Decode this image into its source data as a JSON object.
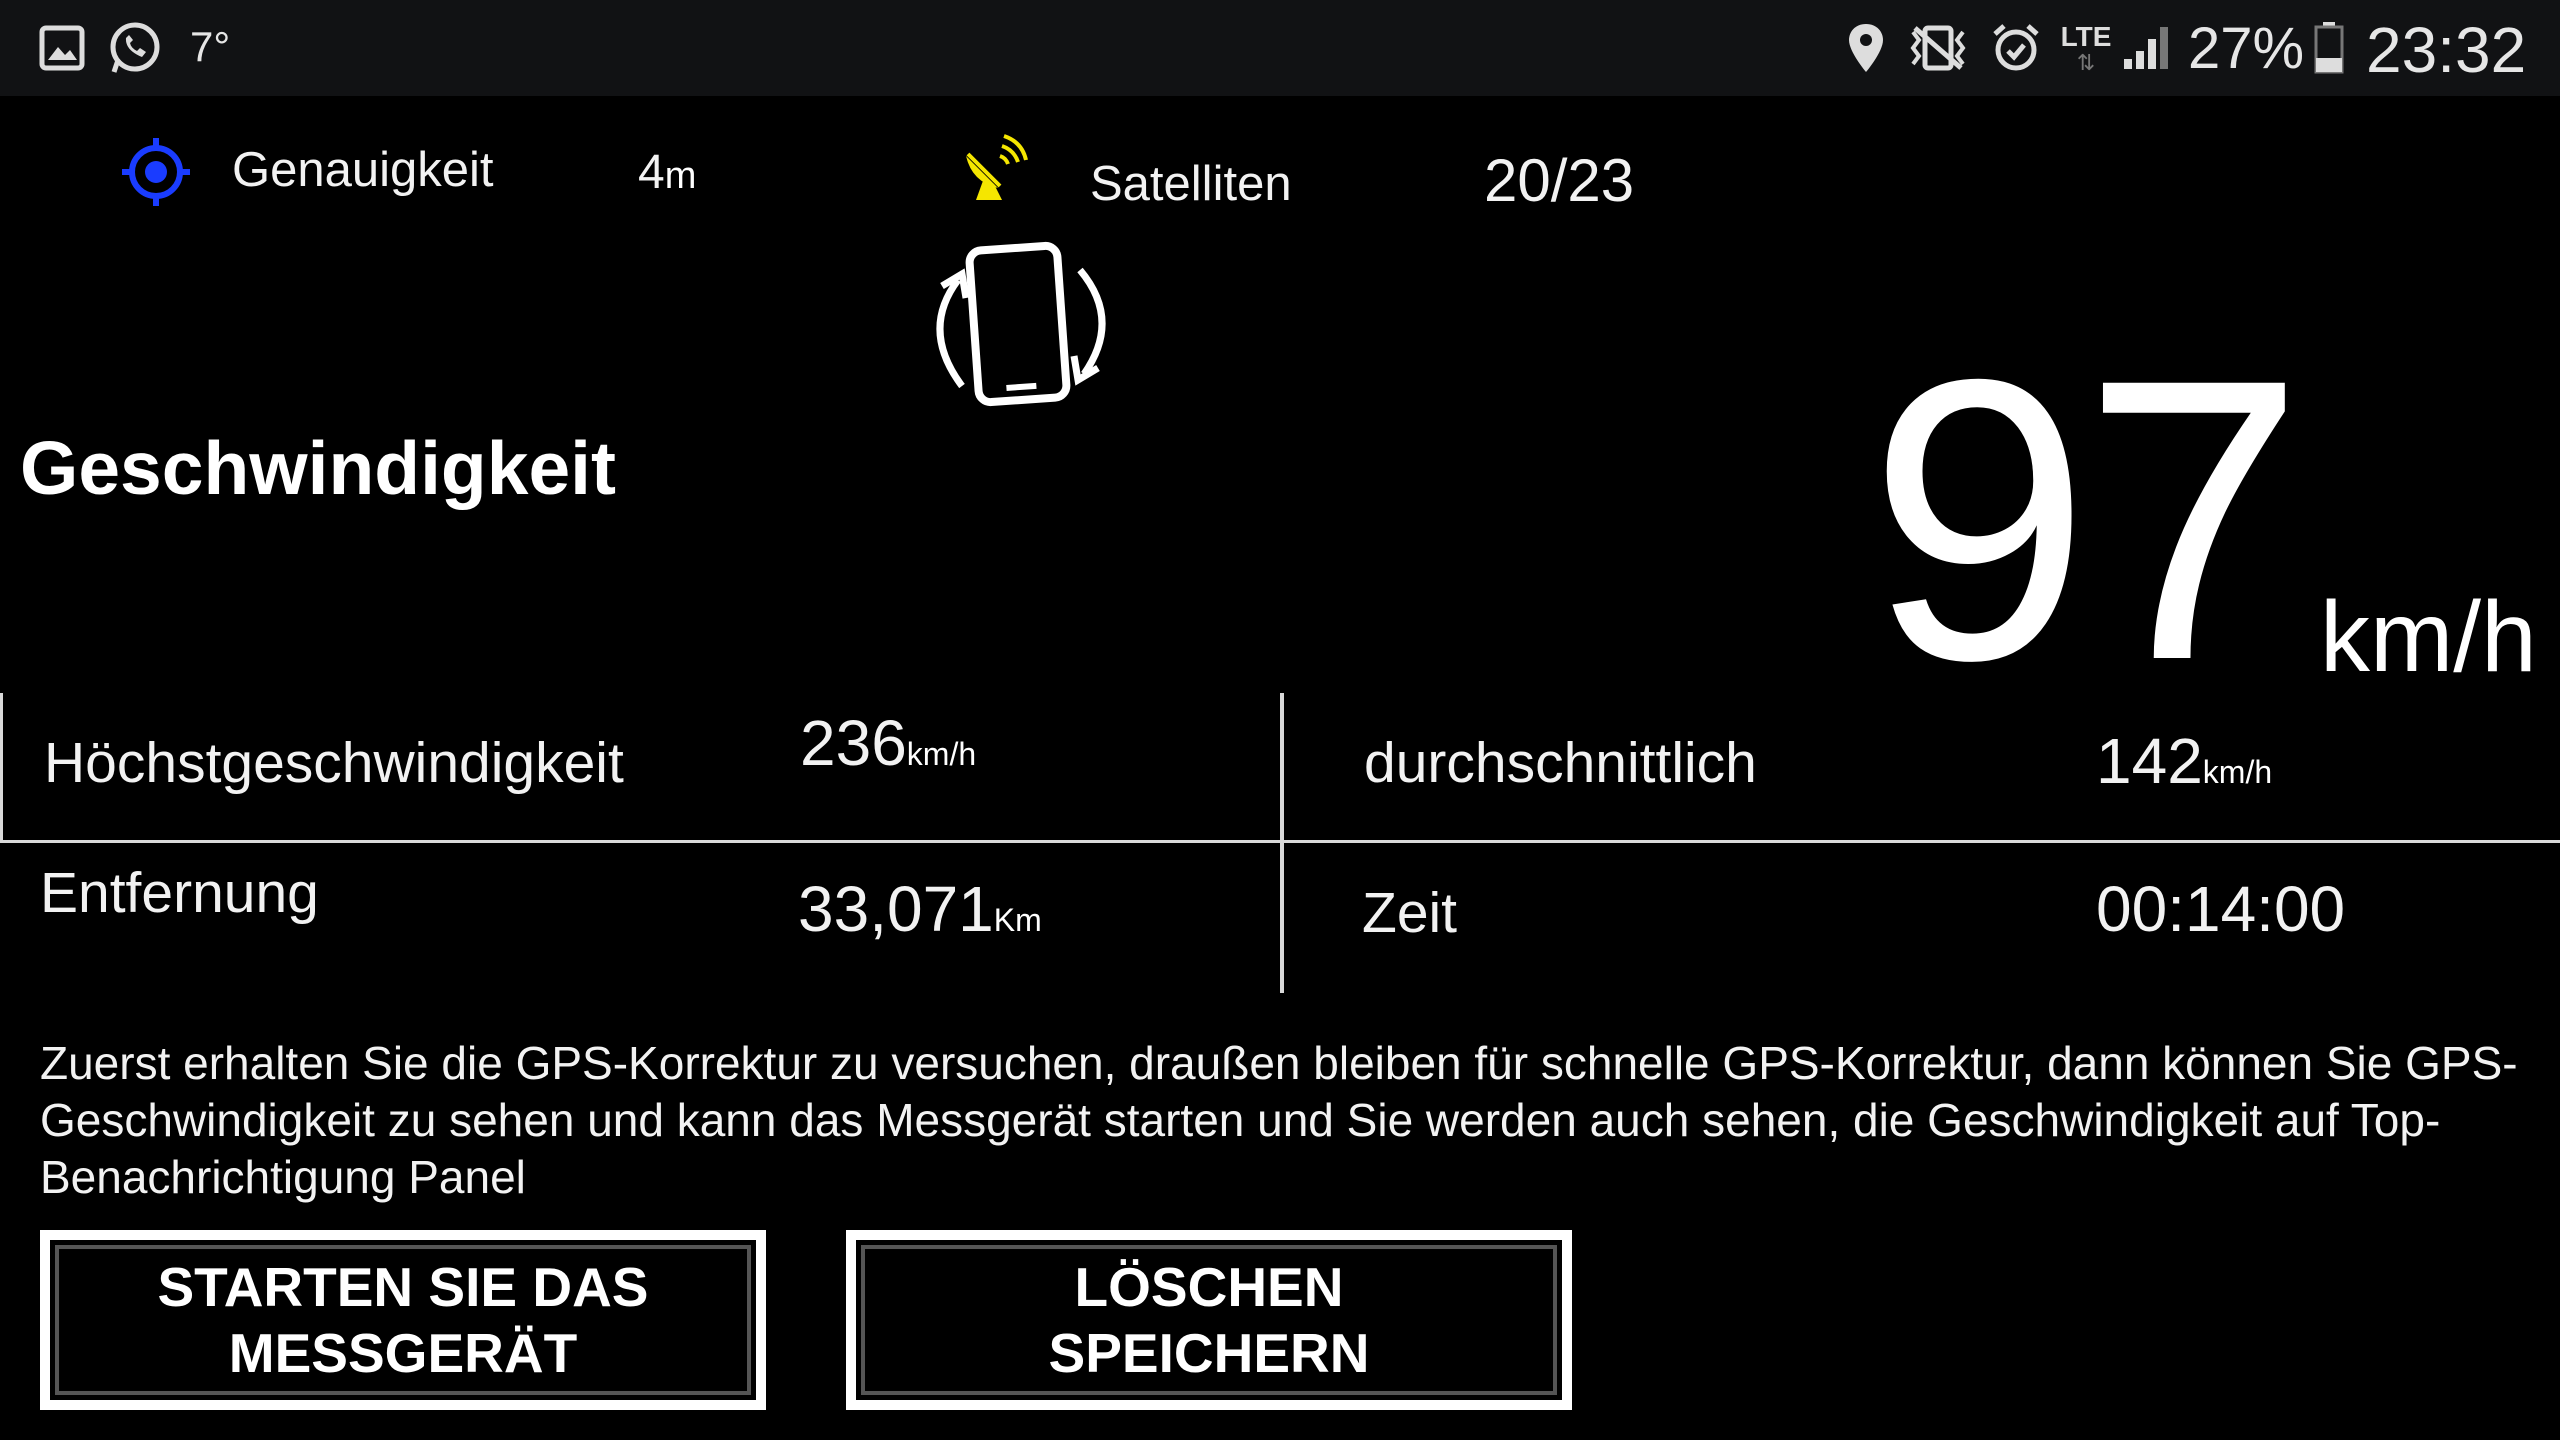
{
  "status_bar": {
    "temperature": "7°",
    "network": "LTE",
    "battery": "27%",
    "time": "23:32",
    "icons": [
      "gallery-icon",
      "whatsapp-icon",
      "location-icon",
      "vibrate-icon",
      "alarm-icon",
      "lte-icon",
      "signal-icon",
      "battery-icon"
    ]
  },
  "gps": {
    "accuracy_label": "Genauigkeit",
    "accuracy_value": "4",
    "accuracy_unit": "m",
    "satellites_label": "Satelliten",
    "satellites_value": "20/23"
  },
  "speed": {
    "label": "Geschwindigkeit",
    "value": "97",
    "unit": "km/h"
  },
  "stats": {
    "max_label": "Höchstgeschwindigkeit",
    "max_value": "236",
    "max_unit": "km/h",
    "avg_label": "durchschnittlich",
    "avg_value": "142",
    "avg_unit": "km/h",
    "distance_label": "Entfernung",
    "distance_value": "33,071",
    "distance_unit": "Km",
    "time_label": "Zeit",
    "time_value": "00:14:00"
  },
  "info_text": "Zuerst erhalten Sie die GPS-Korrektur zu versuchen, draußen bleiben für schnelle GPS-Korrektur, dann können Sie GPS-Geschwindigkeit zu sehen und kann das Messgerät starten und Sie werden auch sehen, die Geschwindigkeit auf Top-Benachrichtigung Panel",
  "buttons": {
    "start_line1": "STARTEN SIE DAS",
    "start_line2": "MESSGERÄT",
    "clear_line1": "LÖSCHEN",
    "clear_line2": "SPEICHERN"
  },
  "colors": {
    "accent_blue": "#1a3cff",
    "satellite_yellow": "#f5e600",
    "background": "#000000"
  }
}
